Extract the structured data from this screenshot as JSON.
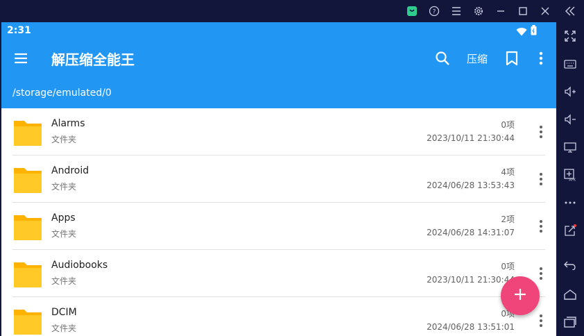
{
  "status_bar": {
    "time": "2:31"
  },
  "app_bar": {
    "title": "解压缩全能王",
    "compress_label": "压缩"
  },
  "path": "/storage/emulated/0",
  "items": [
    {
      "name": "Alarms",
      "type": "文件夹",
      "count": "0项",
      "date": "2023/10/11 21:30:44"
    },
    {
      "name": "Android",
      "type": "文件夹",
      "count": "4项",
      "date": "2024/06/28 13:53:43"
    },
    {
      "name": "Apps",
      "type": "文件夹",
      "count": "2项",
      "date": "2024/06/28 14:31:07"
    },
    {
      "name": "Audiobooks",
      "type": "文件夹",
      "count": "0项",
      "date": "2023/10/11 21:30:44"
    },
    {
      "name": "DCIM",
      "type": "文件夹",
      "count": "0项",
      "date": "2024/06/28 13:51:01"
    }
  ],
  "colors": {
    "primary": "#2196f3",
    "fab": "#f0457a",
    "folder": "#ffc928"
  },
  "emulator_icons_top": [
    "store-icon",
    "help-icon",
    "hamburger-icon",
    "settings-icon",
    "minimize-icon",
    "maximize-icon",
    "close-icon",
    "collapse-icon"
  ],
  "emulator_icons_side": [
    "fullscreen-icon",
    "keyboard-icon",
    "volume-up-icon",
    "volume-down-icon",
    "screen-icon",
    "apk-install-icon",
    "more-icon",
    "share-icon",
    "back-icon",
    "home-icon",
    "recents-icon"
  ]
}
